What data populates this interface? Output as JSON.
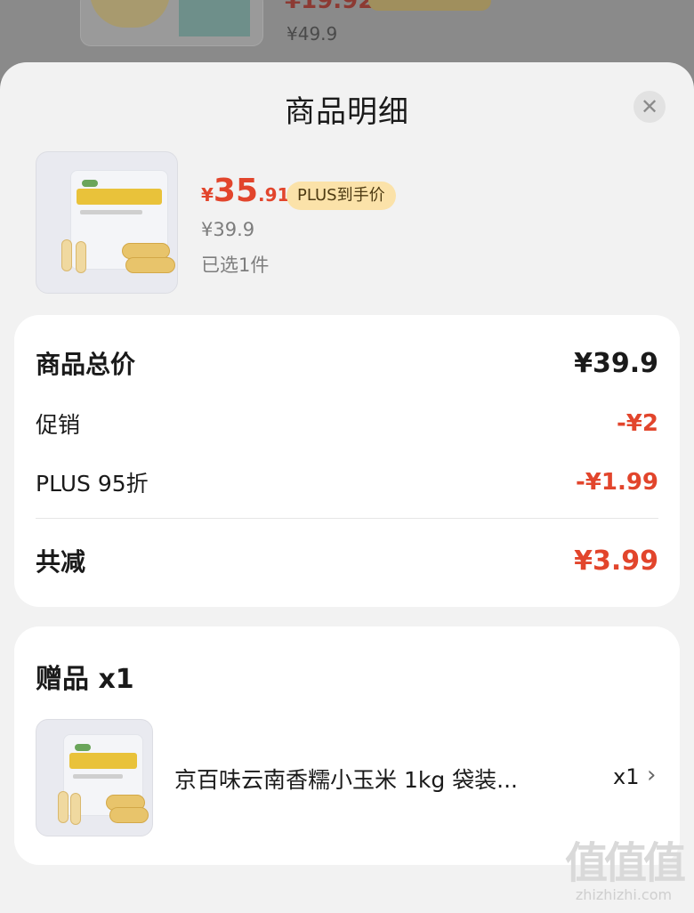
{
  "background": {
    "price_partial": "¥19.92",
    "original_price": "¥49.9"
  },
  "sheet": {
    "title": "商品明细",
    "close_icon": "close-icon"
  },
  "product": {
    "price_symbol": "¥",
    "price_integer": "35",
    "price_decimal": ".91",
    "plus_badge": "PLUS到手价",
    "original_price": "¥39.9",
    "selected": "已选1件"
  },
  "summary": {
    "total_label": "商品总价",
    "total_value": "¥39.9",
    "promo_label": "促销",
    "promo_value": "-¥2",
    "plus_label": "PLUS 95折",
    "plus_value": "-¥1.99",
    "reduced_label": "共减",
    "reduced_value": "¥3.99"
  },
  "gift": {
    "title": "赠品 x1",
    "name": "京百味云南香糯小玉米 1kg 袋装...",
    "quantity": "x1",
    "chevron": "chevron-right-icon"
  },
  "watermark": {
    "url": "zhizhizhi.com"
  },
  "colors": {
    "accent_red": "#e2452c",
    "plus_badge_bg": "#fbe2a9",
    "sheet_bg": "#f2f2f2",
    "card_bg": "#ffffff"
  }
}
